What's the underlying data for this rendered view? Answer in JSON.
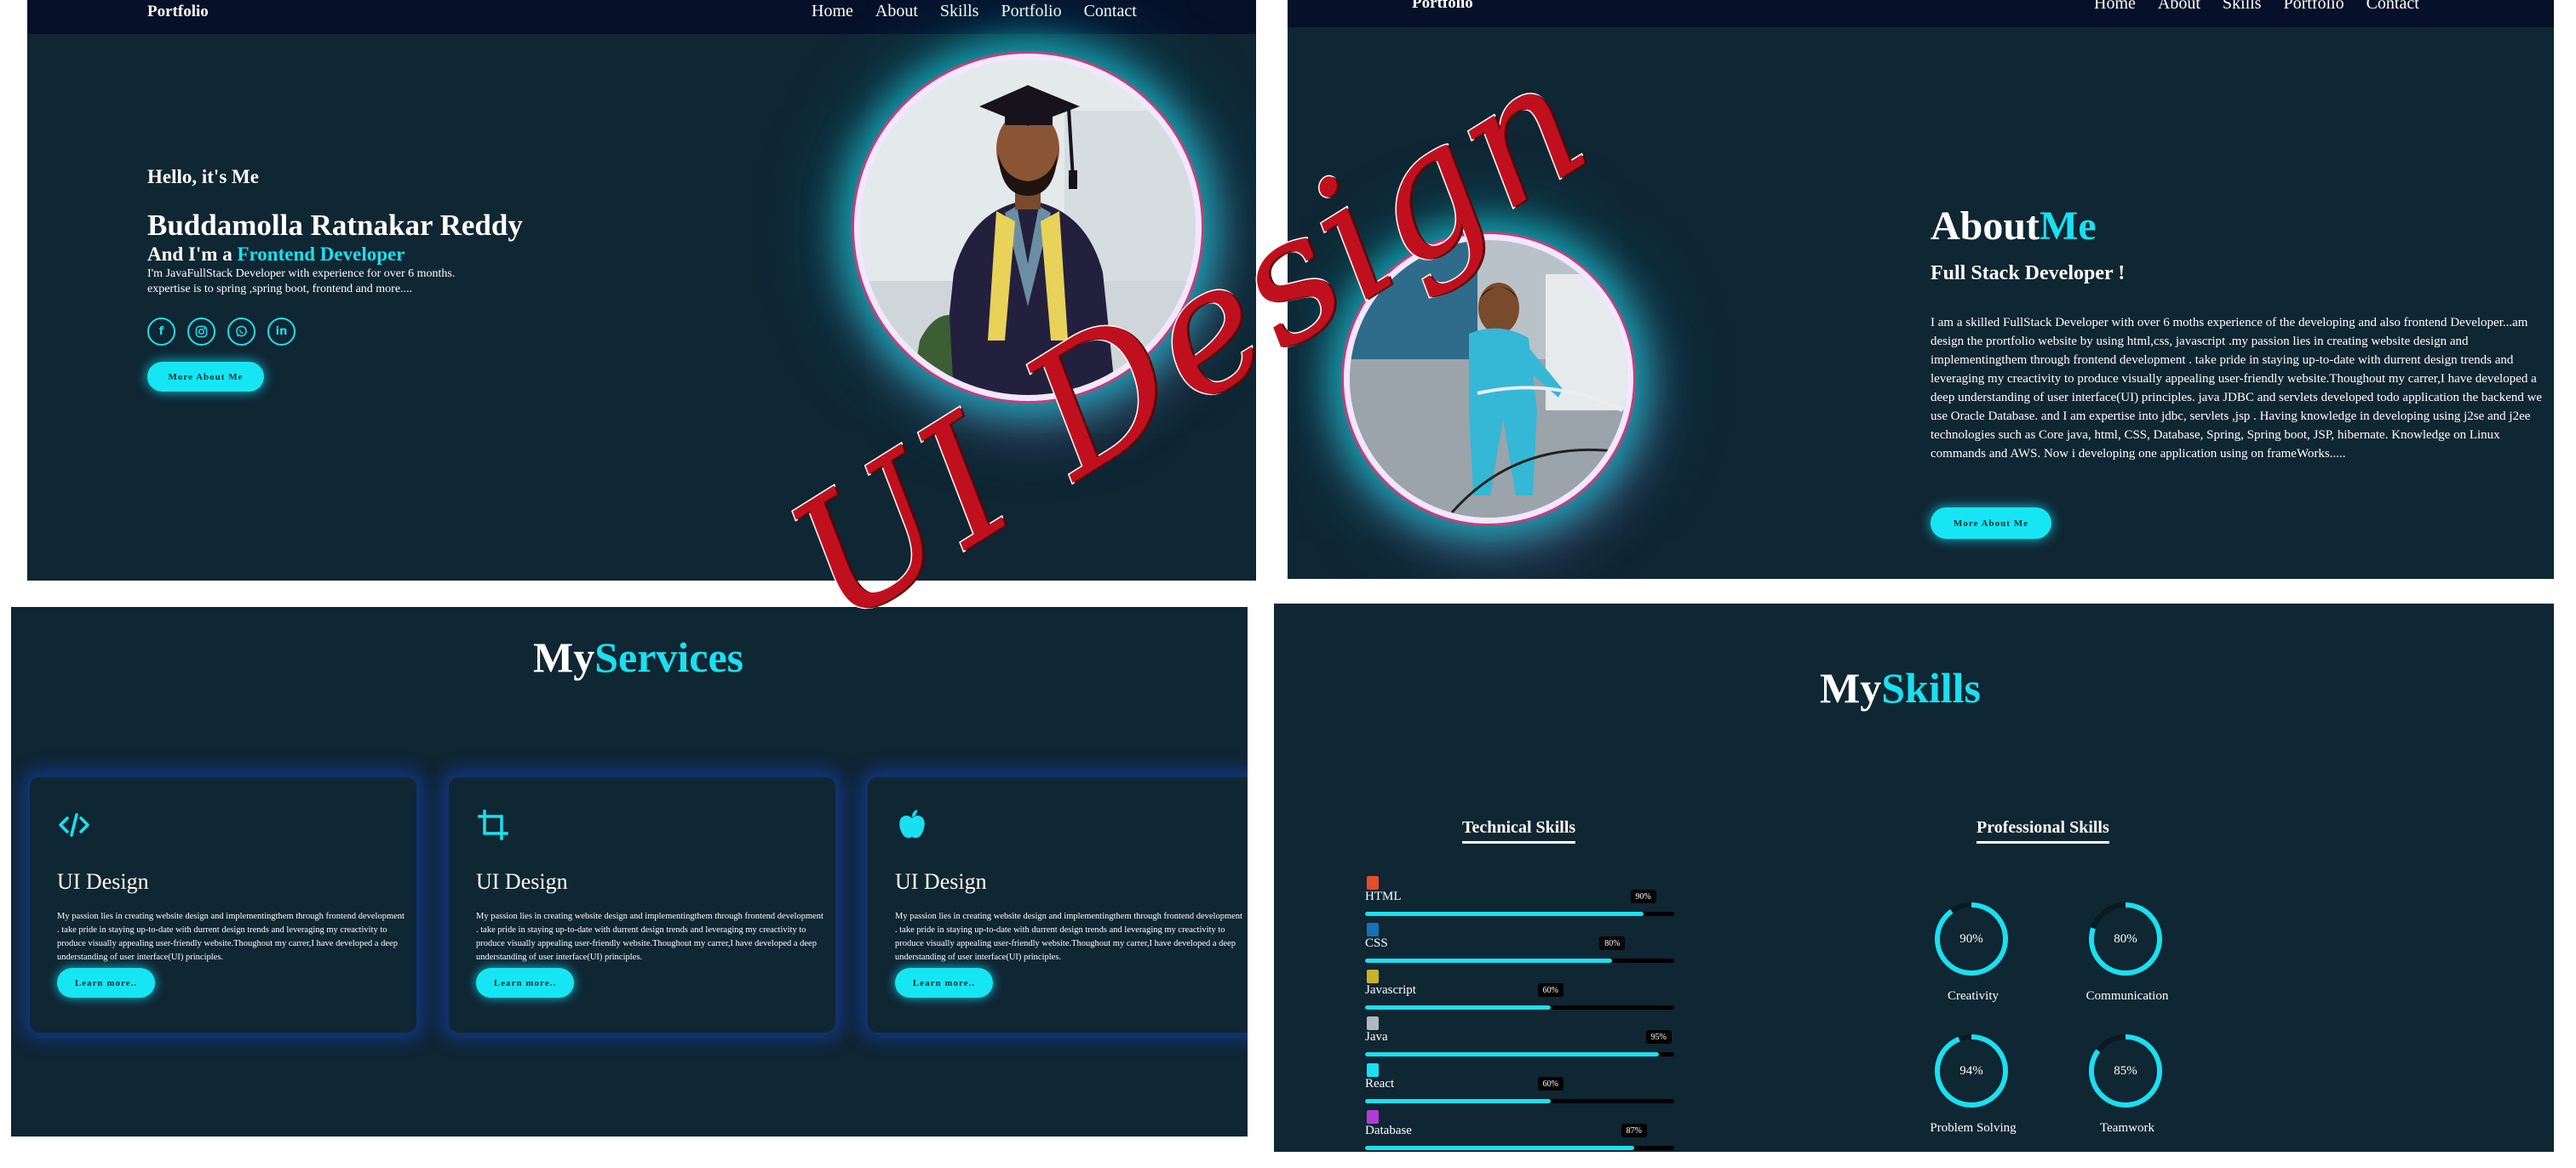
{
  "home": {
    "nav": {
      "logo": "Portfolio",
      "links": [
        "Home",
        "About",
        "Skills",
        "Portfolio",
        "Contact"
      ]
    },
    "greeting": "Hello, it's Me",
    "name": "Buddamolla Ratnakar Reddy",
    "role_prefix": "And I'm a ",
    "role": "Frontend Developer",
    "description_1": "I'm JavaFullStack Developer with experience for over 6 months.",
    "description_2": "expertise is to spring ,spring boot, frontend and more....",
    "socials": [
      "facebook-icon",
      "instagram-icon",
      "whatsapp-icon",
      "linkedin-icon"
    ],
    "button": "More About Me"
  },
  "about": {
    "nav": {
      "logo": "Portfolio",
      "links": [
        "Home",
        "About",
        "Skills",
        "Portfolio",
        "Contact"
      ]
    },
    "title_white": "About",
    "title_accent": "Me",
    "subtitle": "Full Stack Developer !",
    "text": "I am a skilled FullStack Developer with over 6 moths experience of the developing and also frontend Developer...am design the prortfolio website by using html,css, javascript .my passion lies in creating website design and implementingthem through frontend development . take pride in staying up-to-date with durrent design trends and leveraging my creactivity to produce visually appealing user-friendly website.Thoughout my carrer,I have developed a deep understanding of user interface(UI) principles. java JDBC and servlets developed todo application the backend we use Oracle Database. and I am expertise into jdbc, servlets ,jsp . Having knowledge in developing using j2se and j2ee technologies such as Core java, html, CSS, Database, Spring, Spring boot, JSP, hibernate. Knowledge on Linux commands and AWS. Now i developing one application using on frameWorks.....",
    "button": "More About Me"
  },
  "services": {
    "title_white": "My",
    "title_accent": "Services",
    "cards": [
      {
        "icon": "code-icon",
        "title": "UI Design",
        "text": "My passion lies in creating website design and implementingthem through frontend development . take pride in staying up-to-date with durrent design trends and leveraging my creactivity to produce visually appealing user-friendly website.Thoughout my carrer,I have developed a deep understanding of user interface(UI) principles.",
        "button": "Learn more.."
      },
      {
        "icon": "crop-icon",
        "title": "UI Design",
        "text": "My passion lies in creating website design and implementingthem through frontend development . take pride in staying up-to-date with durrent design trends and leveraging my creactivity to produce visually appealing user-friendly website.Thoughout my carrer,I have developed a deep understanding of user interface(UI) principles.",
        "button": "Learn more.."
      },
      {
        "icon": "apple-icon",
        "title": "UI Design",
        "text": "My passion lies in creating website design and implementingthem through frontend development . take pride in staying up-to-date with durrent design trends and leveraging my creactivity to produce visually appealing user-friendly website.Thoughout my carrer,I have developed a deep understanding of user interface(UI) principles.",
        "button": "Learn more.."
      }
    ]
  },
  "skills": {
    "title_white": "My",
    "title_accent": "Skills",
    "technical_title": "Technical Skills",
    "professional_title": "Professional Skills",
    "technical": [
      {
        "label": "HTML",
        "percent": 90,
        "percent_text": "90%",
        "icon": "html5-icon",
        "color": "#e44d26"
      },
      {
        "label": "CSS",
        "percent": 80,
        "percent_text": "80%",
        "icon": "css3-icon",
        "color": "#1572b6"
      },
      {
        "label": "Javascript",
        "percent": 60,
        "percent_text": "60%",
        "icon": "javascript-icon",
        "color": "#c9b12a"
      },
      {
        "label": "Java",
        "percent": 95,
        "percent_text": "95%",
        "icon": "java-icon",
        "color": "#b0b8c0"
      },
      {
        "label": "React",
        "percent": 60,
        "percent_text": "60%",
        "icon": "react-icon",
        "color": "#19e0f0"
      },
      {
        "label": "Database",
        "percent": 87,
        "percent_text": "87%",
        "icon": "database-icon",
        "color": "#b23bd6"
      }
    ],
    "professional": [
      {
        "label": "Creativity",
        "percent": 90,
        "percent_text": "90%"
      },
      {
        "label": "Communication",
        "percent": 80,
        "percent_text": "80%"
      },
      {
        "label": "Problem Solving",
        "percent": 94,
        "percent_text": "94%"
      },
      {
        "label": "Teamwork",
        "percent": 85,
        "percent_text": "85%"
      }
    ]
  },
  "watermark": "UI Design",
  "colors": {
    "accent": "#19e0f0",
    "panel": "#0f2633",
    "navbar": "#061029",
    "watermark": "#c0101e"
  }
}
